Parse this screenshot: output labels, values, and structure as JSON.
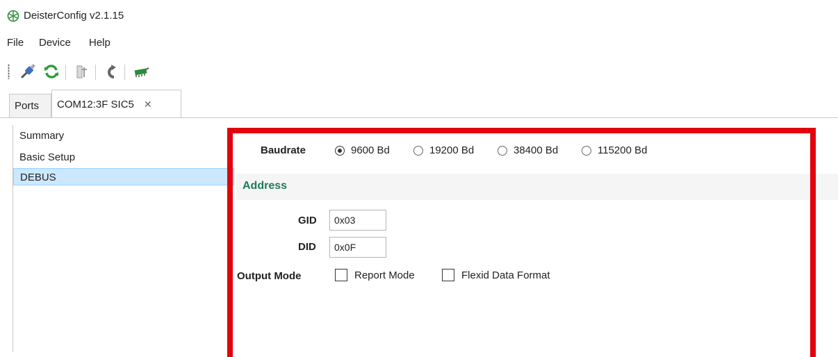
{
  "window": {
    "title": "DeisterConfig v2.1.15"
  },
  "menu": {
    "items": [
      "File",
      "Device",
      "Help"
    ]
  },
  "toolbar": {
    "buttons": [
      "connect-icon",
      "refresh-icon",
      "device-settings-icon",
      "undo-icon",
      "chip-icon"
    ]
  },
  "tabs": [
    {
      "label": "Ports",
      "active": false
    },
    {
      "label": "COM12:3F SIC5",
      "active": true,
      "close": "✕"
    }
  ],
  "nav": {
    "items": [
      {
        "label": "Summary",
        "selected": false
      },
      {
        "label": "Basic Setup",
        "selected": false
      },
      {
        "label": "DEBUS",
        "selected": true
      }
    ]
  },
  "form": {
    "baudrate": {
      "label": "Baudrate",
      "options": [
        "9600 Bd",
        "19200 Bd",
        "38400 Bd",
        "115200 Bd"
      ],
      "selected": "9600 Bd"
    },
    "address_section": {
      "title": "Address"
    },
    "gid": {
      "label": "GID",
      "value": "0x03"
    },
    "did": {
      "label": "DID",
      "value": "0x0F"
    },
    "output_mode": {
      "label": "Output Mode",
      "options": [
        {
          "label": "Report Mode",
          "checked": false
        },
        {
          "label": "Flexid Data Format",
          "checked": false
        }
      ]
    }
  },
  "colors": {
    "section_title": "#1e7a5a",
    "highlight": "#e3000f",
    "selected_bg": "#cce8ff",
    "accent_green": "#2e8b3a"
  }
}
